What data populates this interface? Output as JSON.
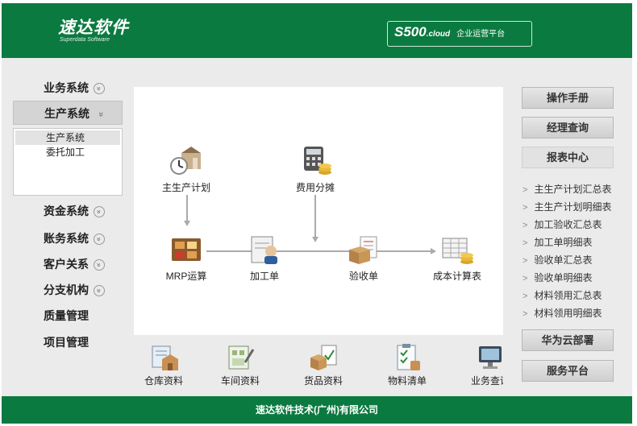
{
  "header": {
    "logo_name": "速达软件",
    "logo_sub": "Superdata Software",
    "product_main": "S500",
    "product_cloud": ".cloud",
    "product_desc": "企业运营平台"
  },
  "nav": {
    "items": [
      {
        "label": "业务系统",
        "chevron": "»"
      },
      {
        "label": "生产系统",
        "chevron": "»",
        "active": true
      },
      {
        "label": "资金系统",
        "chevron": "»"
      },
      {
        "label": "账务系统",
        "chevron": "»"
      },
      {
        "label": "客户关系",
        "chevron": "»"
      },
      {
        "label": "分支机构",
        "chevron": "»"
      },
      {
        "label": "质量管理"
      },
      {
        "label": "项目管理"
      }
    ],
    "sub_items": [
      {
        "label": "生产系统",
        "selected": true
      },
      {
        "label": "委托加工"
      }
    ]
  },
  "flow": {
    "nodes": [
      {
        "id": "plan",
        "label": "主生产计划",
        "icon": "factory-clock-icon"
      },
      {
        "id": "cost",
        "label": "费用分摊",
        "icon": "calculator-coins-icon"
      },
      {
        "id": "mrp",
        "label": "MRP运算",
        "icon": "mrp-grid-icon"
      },
      {
        "id": "process",
        "label": "加工单",
        "icon": "worker-document-icon"
      },
      {
        "id": "receive",
        "label": "验收单",
        "icon": "box-document-icon"
      },
      {
        "id": "costsheet",
        "label": "成本计算表",
        "icon": "spreadsheet-coins-icon"
      }
    ]
  },
  "tiles": [
    {
      "label": "仓库资料",
      "icon": "warehouse-icon"
    },
    {
      "label": "车间资料",
      "icon": "workshop-icon"
    },
    {
      "label": "货品资料",
      "icon": "goods-icon"
    },
    {
      "label": "物料清单",
      "icon": "checklist-icon"
    },
    {
      "label": "业务查询",
      "icon": "monitor-search-icon"
    }
  ],
  "right": {
    "manual": "操作手册",
    "manager_query": "经理查询",
    "report_center": "报表中心",
    "reports": [
      "主生产计划汇总表",
      "主生产计划明细表",
      "加工验收汇总表",
      "加工单明细表",
      "验收单汇总表",
      "验收单明细表",
      "材料领用汇总表",
      "材料领用明细表"
    ],
    "huawei": "华为云部署",
    "service": "服务平台"
  },
  "footer": {
    "company": "速达软件技术(广州)有限公司"
  },
  "colors": {
    "brand_green": "#0b7a40",
    "background": "#ebebeb"
  }
}
